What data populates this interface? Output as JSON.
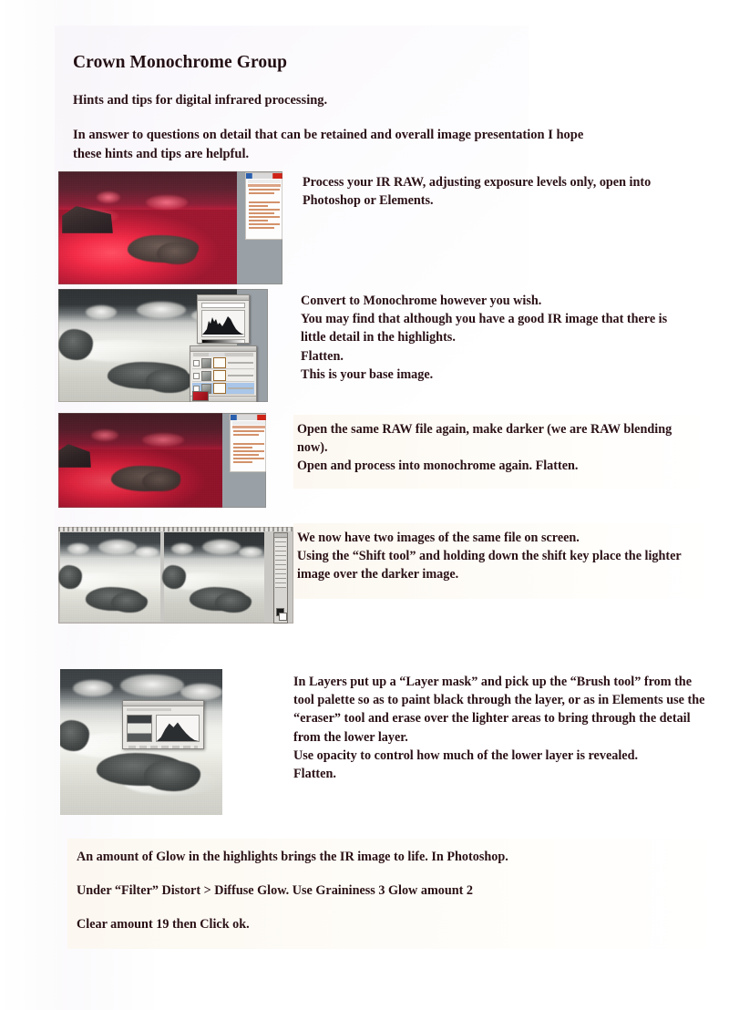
{
  "document": {
    "title": "Crown Monochrome Group",
    "subtitle": "Hints and tips for digital infrared processing.",
    "intro": "In answer to questions on detail that can be retained and overall image presentation I hope these hints and tips are helpful."
  },
  "steps": [
    {
      "id": "step-1",
      "text": "Process your IR RAW, adjusting exposure levels only, open into Photoshop or Elements.",
      "screenshot": "ir-raw-red-converter"
    },
    {
      "id": "step-2",
      "text": "Convert to Monochrome however you wish.\nYou may find that although you have a good IR image that there is little detail in the highlights.\nFlatten.\nThis is your base image.",
      "screenshot": "monochrome-with-levels-and-layers"
    },
    {
      "id": "step-3",
      "text": "Open the same RAW file again, make darker (we are RAW blending now).\nOpen and process into monochrome again. Flatten.",
      "screenshot": "ir-raw-red-darker-converter"
    },
    {
      "id": "step-4",
      "text": "We now have two images of the same file on screen.\nUsing the “Shift tool” and holding down the shift key place the lighter image over the darker image.",
      "screenshot": "two-monochrome-images-side-by-side"
    },
    {
      "id": "step-5",
      "text": "In Layers put up a “Layer mask” and pick up the “Brush tool” from the tool palette so as to paint black through the layer, or as in Elements use the “eraser” tool and erase over the lighter areas to bring through the detail from the lower layer.\nUse opacity to control how much of the lower layer is revealed.\nFlatten.",
      "screenshot": "monochrome-with-dialog"
    }
  ],
  "footer": {
    "line1": "An amount of Glow in the highlights brings the IR image to life. In Photoshop.",
    "line2": "Under “Filter” Distort > Diffuse Glow. Use Graininess  3      Glow amount  2",
    "line3": "Clear amount   19      then Click ok.",
    "settings": {
      "graininess": "3",
      "glow_amount": "2",
      "clear_amount": "19"
    }
  },
  "colors": {
    "text": "#2a1116",
    "page_bg": "#ffffff",
    "ir_red": "#ef2f4d",
    "screen_grey": "#9aa1a6",
    "text_block_tint": "#fcf8f0"
  }
}
